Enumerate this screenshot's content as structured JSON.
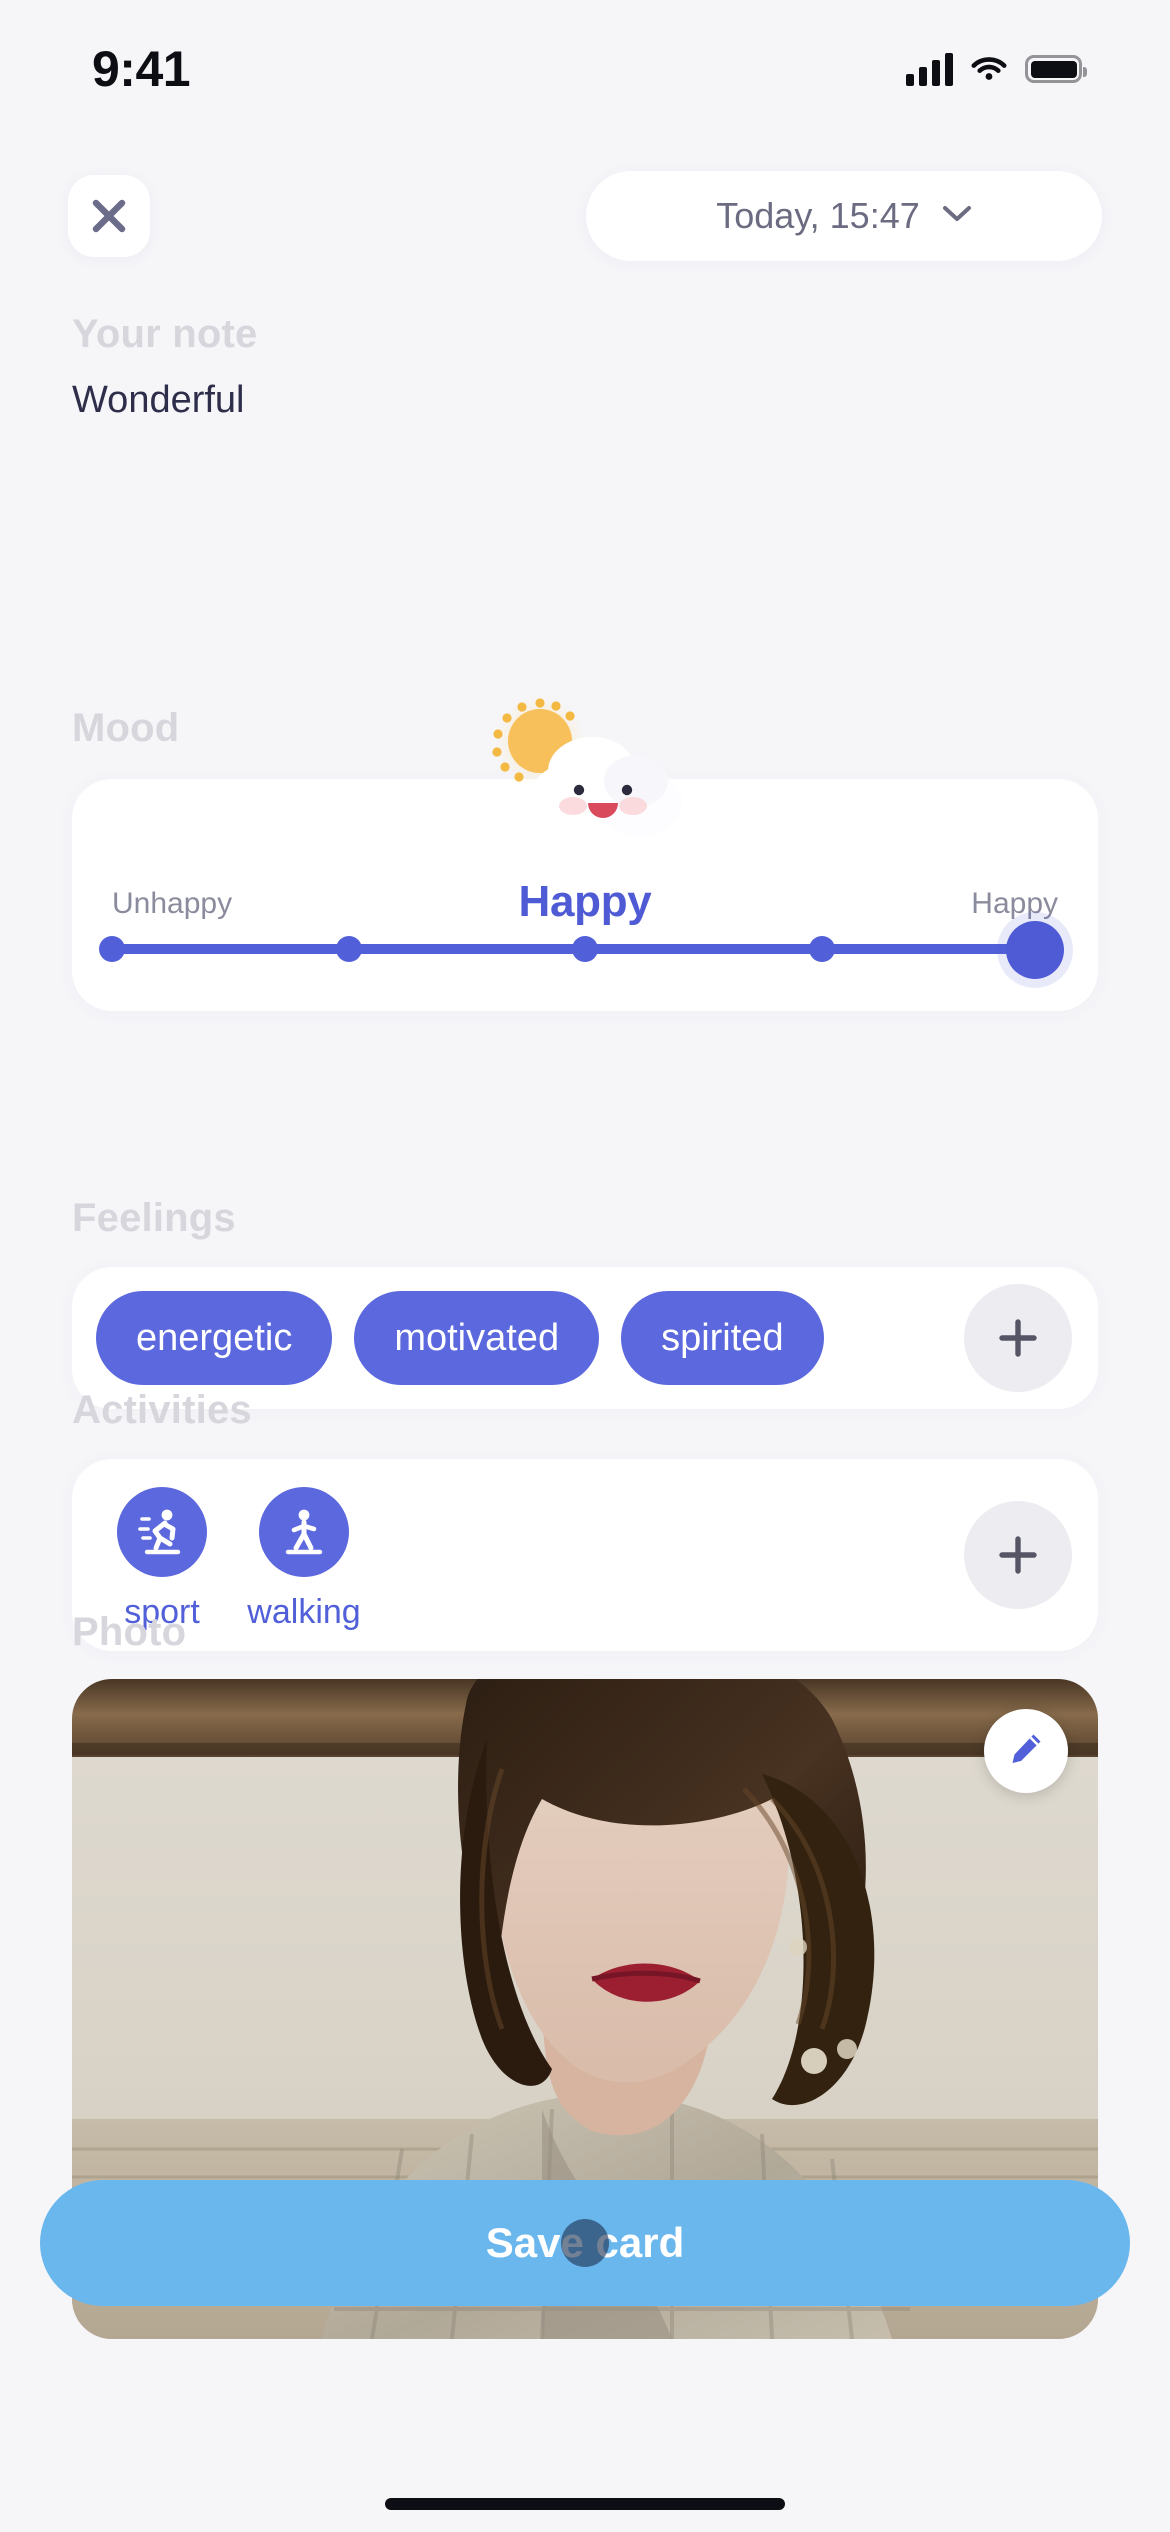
{
  "status_bar": {
    "time": "9:41",
    "signal_icon": "cellular-signal-icon",
    "wifi_icon": "wifi-icon",
    "battery_icon": "battery-icon"
  },
  "top_bar": {
    "close_icon": "close-icon",
    "date_label": "Today, 15:47",
    "chevron_icon": "chevron-down-icon"
  },
  "note": {
    "label": "Your note",
    "value": "Wonderful",
    "placeholder": "Your note"
  },
  "mood": {
    "label": "Mood",
    "illustration": "sun-behind-cloud-happy-face-icon",
    "current": "Happy",
    "scale_min_label": "Unhappy",
    "scale_max_label": "Happy",
    "steps": 5,
    "value": 5,
    "accent_color": "#4f5bd5",
    "track_color": "#5160d8"
  },
  "feelings": {
    "label": "Feelings",
    "chips": [
      "energetic",
      "motivated",
      "spirited"
    ],
    "add_icon": "plus-icon",
    "chip_color": "#5c68dd"
  },
  "activities": {
    "label": "Activities",
    "items": [
      {
        "label": "sport",
        "icon": "running-person-icon"
      },
      {
        "label": "walking",
        "icon": "walking-person-icon"
      }
    ],
    "add_icon": "plus-icon",
    "icon_bg_color": "#5c68dd",
    "label_color": "#5160d8"
  },
  "photo": {
    "label": "Photo",
    "edit_icon": "pencil-edit-icon",
    "alt": "portrait-photo"
  },
  "footer": {
    "save_label": "Save card",
    "save_color": "#6ab7ee",
    "cursor": "pointer-cursor"
  }
}
